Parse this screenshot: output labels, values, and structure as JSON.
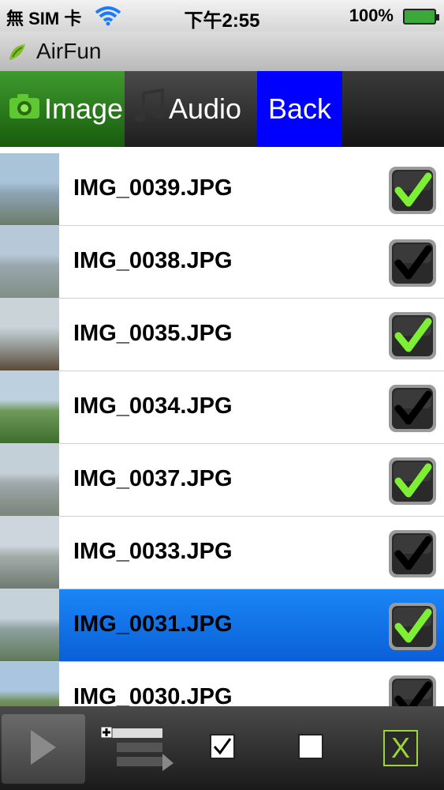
{
  "status_bar": {
    "carrier": "無 SIM 卡",
    "time": "下午2:55",
    "battery": "100%"
  },
  "app": {
    "title": "AirFun"
  },
  "tabs": {
    "image": "Image",
    "audio": "Audio",
    "back": "Back"
  },
  "files": [
    {
      "name": "IMG_0039.JPG",
      "checked": true,
      "selected": false
    },
    {
      "name": "IMG_0038.JPG",
      "checked": false,
      "selected": false
    },
    {
      "name": "IMG_0035.JPG",
      "checked": true,
      "selected": false
    },
    {
      "name": "IMG_0034.JPG",
      "checked": false,
      "selected": false
    },
    {
      "name": "IMG_0037.JPG",
      "checked": true,
      "selected": false
    },
    {
      "name": "IMG_0033.JPG",
      "checked": false,
      "selected": false
    },
    {
      "name": "IMG_0031.JPG",
      "checked": true,
      "selected": true
    },
    {
      "name": "IMG_0030.JPG",
      "checked": false,
      "selected": false
    }
  ],
  "toolbar": {
    "close_label": "X"
  },
  "colors": {
    "back_tab": "#0000ff",
    "selected_row": "#1a86f5",
    "check_green": "#7ef034",
    "image_tab": "#2e7d1e"
  },
  "icons": [
    "wifi-icon",
    "battery-icon",
    "app-logo-icon",
    "camera-icon",
    "music-note-icon",
    "play-icon",
    "playlist-add-icon",
    "select-all-icon",
    "deselect-all-icon",
    "close-icon"
  ]
}
